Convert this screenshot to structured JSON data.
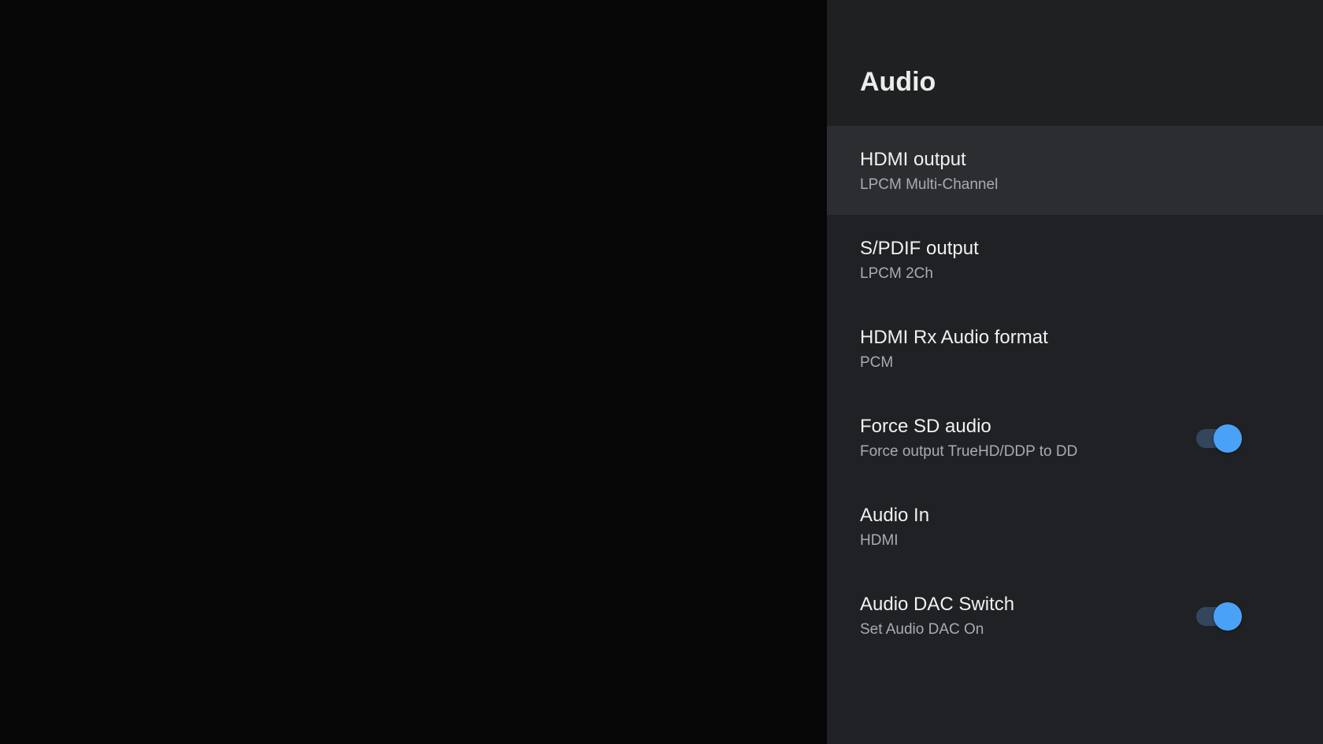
{
  "panel": {
    "title": "Audio"
  },
  "items": [
    {
      "title": "HDMI output",
      "subtitle": "LPCM Multi-Channel"
    },
    {
      "title": "S/PDIF output",
      "subtitle": "LPCM 2Ch"
    },
    {
      "title": "HDMI Rx Audio format",
      "subtitle": "PCM"
    },
    {
      "title": "Force SD audio",
      "subtitle": "Force output TrueHD/DDP to DD",
      "toggle": "on"
    },
    {
      "title": "Audio In",
      "subtitle": "HDMI"
    },
    {
      "title": "Audio DAC Switch",
      "subtitle": "Set Audio DAC On",
      "toggle": "on"
    }
  ],
  "colors": {
    "panel_background": "#202124",
    "selected_row": "#2c2d30",
    "toggle_thumb": "#4aa2f7",
    "toggle_track": "#34465e"
  }
}
